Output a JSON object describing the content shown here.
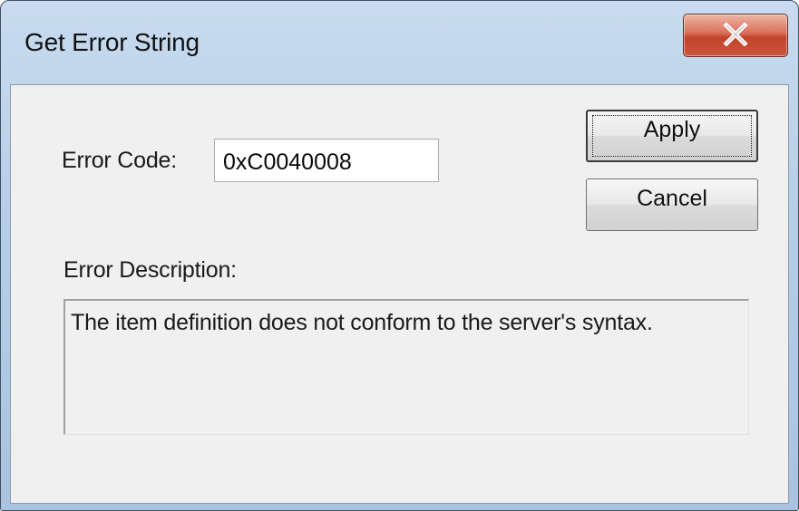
{
  "window": {
    "title": "Get Error String",
    "close_icon": "close-x-icon"
  },
  "form": {
    "error_code_label": "Error Code:",
    "error_code_value": "0xC0040008",
    "error_description_label": "Error Description:",
    "error_description_value": "The item definition does not conform to the server's syntax."
  },
  "buttons": {
    "apply_label": "Apply",
    "cancel_label": "Cancel"
  },
  "colors": {
    "close_button": "#c8563b",
    "dialog_background": "#f0f0f0",
    "frame": "#b6cde6"
  }
}
